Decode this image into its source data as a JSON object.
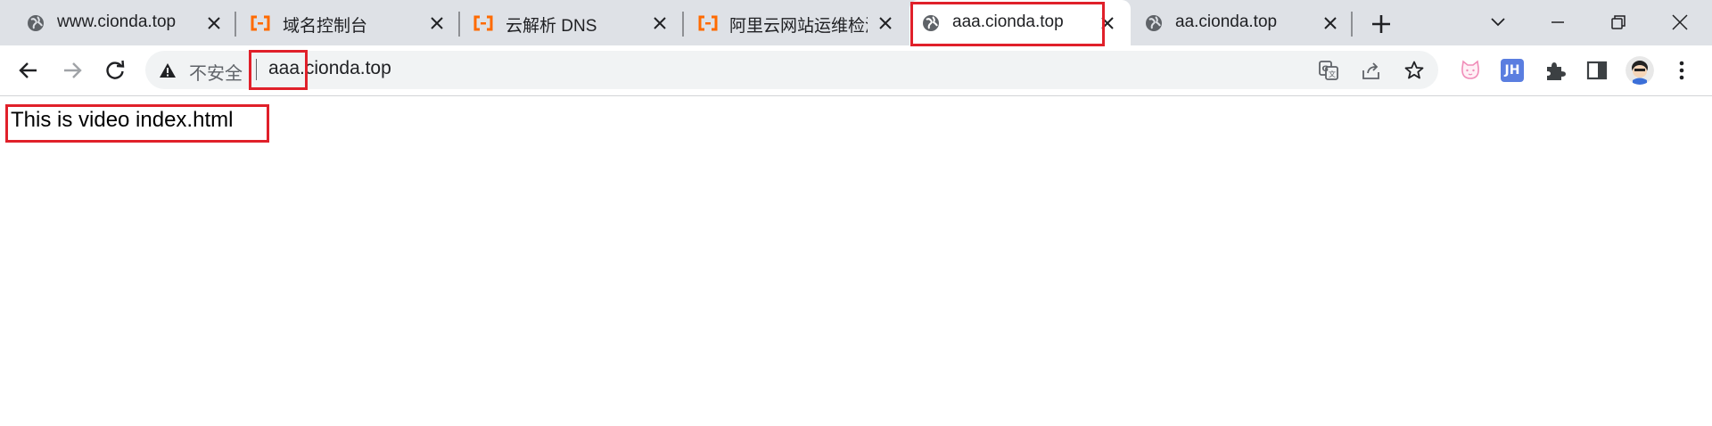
{
  "tabs": [
    {
      "title": "www.cionda.top",
      "icon": "globe-icon",
      "active": false
    },
    {
      "title": "域名控制台",
      "icon": "aliyun-icon",
      "active": false
    },
    {
      "title": "云解析 DNS",
      "icon": "aliyun-icon",
      "active": false
    },
    {
      "title": "阿里云网站运维检测",
      "icon": "aliyun-icon",
      "active": false
    },
    {
      "title": "aaa.cionda.top",
      "icon": "globe-icon",
      "active": true
    },
    {
      "title": "aa.cionda.top",
      "icon": "globe-icon",
      "active": false
    }
  ],
  "omnibox": {
    "security_label": "不安全",
    "url": "aaa.cionda.top"
  },
  "page": {
    "body_text": "This is video index.html"
  },
  "colors": {
    "tabstrip_bg": "#dee1e6",
    "aliyun_orange": "#ff6a00",
    "annotation_red": "#e0202a",
    "extension_jh_blue": "#5a7ee0"
  },
  "extensions": [
    "cat-extension-icon",
    "jh-extension-icon",
    "puzzle-extensions-icon"
  ]
}
